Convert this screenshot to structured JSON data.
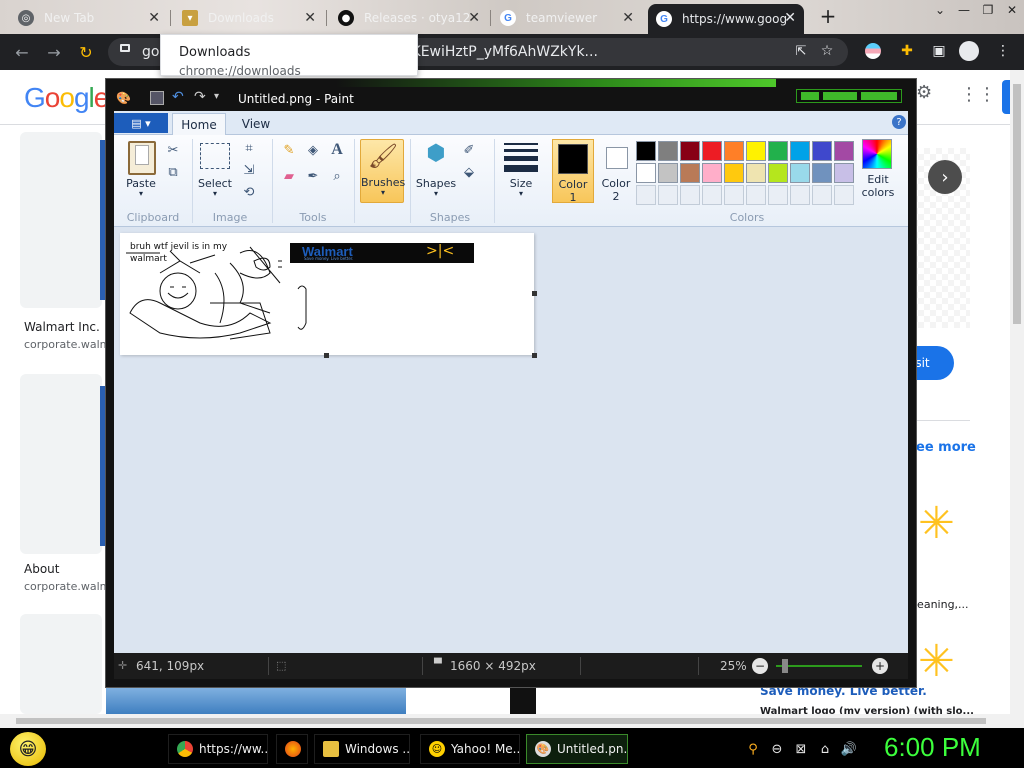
{
  "browser": {
    "tabs": [
      {
        "title": "New Tab",
        "icon": "chrome-icon"
      },
      {
        "title": "Downloads",
        "icon": "downloads-icon"
      },
      {
        "title": "Releases · otya12",
        "icon": "github-icon"
      },
      {
        "title": "teamviewer",
        "icon": "google-icon"
      },
      {
        "title": "https://www.goog",
        "icon": "google-icon",
        "active": true
      }
    ],
    "new_tab": "+",
    "url": "goo… source=lnms&sa=X&ved=2ahUKEwiHztP_yMf6AhWZkYk...",
    "downloads_popup": {
      "title": "Downloads",
      "url": "chrome://downloads"
    }
  },
  "google_page": {
    "logo": "Google",
    "results": [
      {
        "title": "Walmart Inc.",
        "source": "corporate.walm"
      },
      {
        "title": "About",
        "source": "corporate.walm"
      }
    ],
    "right_col": {
      "visit": "isit",
      "see_more": "ee more",
      "caption1": "leaning,...",
      "caption2": "Save money. Live better.",
      "caption3": "Walmart logo (my version) (with slo..."
    }
  },
  "paint": {
    "title": "Untitled.png - Paint",
    "tabs": [
      "Home",
      "View"
    ],
    "ribbon": {
      "clipboard": {
        "label": "Clipboard",
        "paste": "Paste"
      },
      "image": {
        "label": "Image",
        "select": "Select"
      },
      "tools": {
        "label": "Tools"
      },
      "brushes": "Brushes",
      "shapes": {
        "label": "Shapes",
        "button": "Shapes"
      },
      "size": "Size",
      "color1": {
        "line1": "Color",
        "line2": "1"
      },
      "color2": {
        "line1": "Color",
        "line2": "2"
      },
      "colors_label": "Colors",
      "edit_colors": {
        "line1": "Edit",
        "line2": "colors"
      }
    },
    "palette_row1": [
      "#000000",
      "#7f7f7f",
      "#880015",
      "#ed1c24",
      "#ff7f27",
      "#fff200",
      "#22b14c",
      "#00a2e8",
      "#3f48cc",
      "#a349a4"
    ],
    "palette_row2": [
      "#ffffff",
      "#c3c3c3",
      "#b97a57",
      "#ffaec9",
      "#ffc90e",
      "#efe4b0",
      "#b5e61d",
      "#99d9ea",
      "#7092be",
      "#c8bfe7"
    ],
    "canvas": {
      "drawing_text": [
        "bruh wtf jevil is in my",
        "walmart"
      ],
      "logo_text": "Walmart",
      "logo_tagline": "Save money. Live better."
    },
    "status": {
      "cursor_pos": "641, 109px",
      "dimensions": "1660 × 492px",
      "zoom": "25%"
    }
  },
  "taskbar": {
    "items": [
      {
        "label": "https://ww...",
        "icon": "chrome-icon"
      },
      {
        "label": "",
        "icon": "firefox-icon"
      },
      {
        "label": "Windows ...",
        "icon": "folder-icon"
      },
      {
        "label": "Yahoo! Me...",
        "icon": "yahoo-messenger-icon"
      },
      {
        "label": "Untitled.pn...",
        "icon": "paint-icon"
      }
    ],
    "clock": "6:00 PM"
  }
}
